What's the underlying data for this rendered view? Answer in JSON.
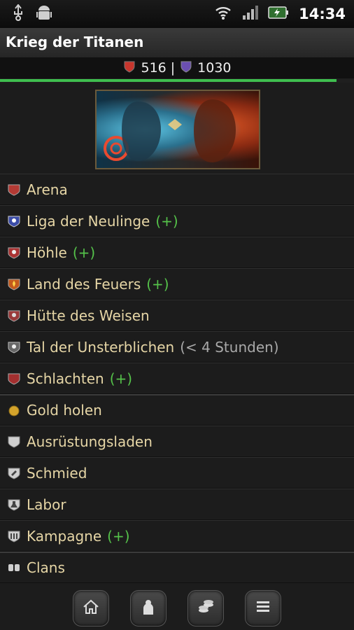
{
  "status_bar": {
    "time": "14:34",
    "icons": [
      "usb-icon",
      "android-icon",
      "wifi-icon",
      "signal-icon",
      "battery-icon"
    ]
  },
  "app": {
    "title": "Krieg der Titanen"
  },
  "resources": {
    "attack_value": "516",
    "separator": "|",
    "defense_value": "1030",
    "progress_percent": 95
  },
  "banner": {
    "image": "titans-fight-banner"
  },
  "menu": {
    "items": [
      {
        "label": "Arena",
        "suffix": "",
        "note": ""
      },
      {
        "label": "Liga der Neulinge",
        "suffix": "(+)",
        "note": ""
      },
      {
        "label": "Höhle",
        "suffix": "(+)",
        "note": ""
      },
      {
        "label": "Land des Feuers",
        "suffix": "(+)",
        "note": ""
      },
      {
        "label": "Hütte des Weisen",
        "suffix": "",
        "note": ""
      },
      {
        "label": "Tal der Unsterblichen",
        "suffix": "",
        "note": "(< 4 Stunden)"
      },
      {
        "label": "Schlachten",
        "suffix": "(+)",
        "note": ""
      },
      {
        "label": "Gold holen",
        "suffix": "",
        "note": ""
      },
      {
        "label": "Ausrüstungsladen",
        "suffix": "",
        "note": ""
      },
      {
        "label": "Schmied",
        "suffix": "",
        "note": ""
      },
      {
        "label": "Labor",
        "suffix": "",
        "note": ""
      },
      {
        "label": "Kampagne",
        "suffix": "(+)",
        "note": ""
      },
      {
        "label": "Clans",
        "suffix": "",
        "note": ""
      }
    ]
  },
  "bottom_nav": {
    "buttons": [
      "home-icon",
      "profile-icon",
      "coins-icon",
      "list-icon"
    ]
  },
  "colors": {
    "background": "#1c1c1c",
    "menu_text": "#e6d6a6",
    "plus_text": "#55c24a",
    "note_text": "#a9a9a9",
    "progress": "#3fbf4f"
  }
}
